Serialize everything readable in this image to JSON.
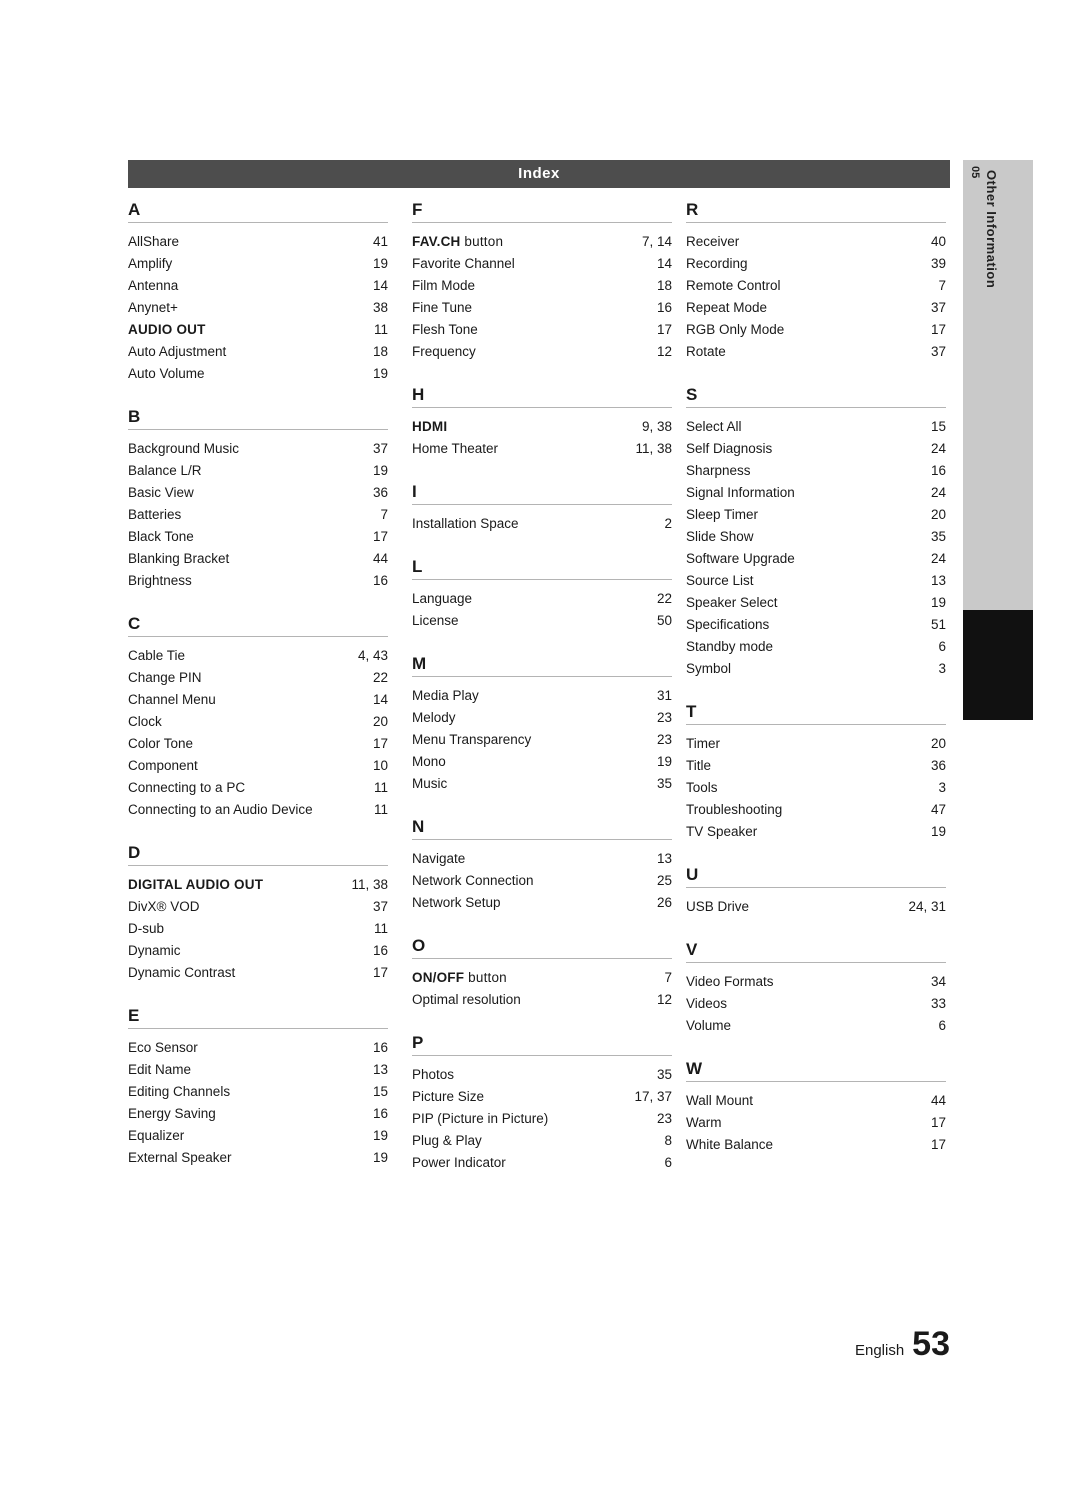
{
  "header": {
    "title": "Index"
  },
  "side_tab": {
    "number": "05",
    "label": "Other Information"
  },
  "footer": {
    "language": "English",
    "page_number": "53"
  },
  "columns": [
    {
      "groups": [
        {
          "letter": "A",
          "entries": [
            {
              "term": "AllShare",
              "page": "41",
              "bold": false
            },
            {
              "term": "Amplify",
              "page": "19",
              "bold": false
            },
            {
              "term": "Antenna",
              "page": "14",
              "bold": false
            },
            {
              "term": "Anynet+",
              "page": "38",
              "bold": false
            },
            {
              "term": "AUDIO OUT",
              "page": "11",
              "bold": true
            },
            {
              "term": "Auto Adjustment",
              "page": "18",
              "bold": false
            },
            {
              "term": "Auto Volume",
              "page": "19",
              "bold": false
            }
          ]
        },
        {
          "letter": "B",
          "entries": [
            {
              "term": "Background Music",
              "page": "37",
              "bold": false
            },
            {
              "term": "Balance L/R",
              "page": "19",
              "bold": false
            },
            {
              "term": "Basic View",
              "page": "36",
              "bold": false
            },
            {
              "term": "Batteries",
              "page": "7",
              "bold": false
            },
            {
              "term": "Black Tone",
              "page": "17",
              "bold": false
            },
            {
              "term": "Blanking Bracket",
              "page": "44",
              "bold": false
            },
            {
              "term": "Brightness",
              "page": "16",
              "bold": false
            }
          ]
        },
        {
          "letter": "C",
          "entries": [
            {
              "term": "Cable Tie",
              "page": "4, 43",
              "bold": false
            },
            {
              "term": "Change PIN",
              "page": "22",
              "bold": false
            },
            {
              "term": "Channel Menu",
              "page": "14",
              "bold": false
            },
            {
              "term": "Clock",
              "page": "20",
              "bold": false
            },
            {
              "term": "Color Tone",
              "page": "17",
              "bold": false
            },
            {
              "term": "Component",
              "page": "10",
              "bold": false
            },
            {
              "term": "Connecting to a PC",
              "page": "11",
              "bold": false
            },
            {
              "term": "Connecting to an Audio Device",
              "page": "11",
              "bold": false
            }
          ]
        },
        {
          "letter": "D",
          "entries": [
            {
              "term": "DIGITAL AUDIO OUT",
              "page": "11, 38",
              "bold": true
            },
            {
              "term": "DivX® VOD",
              "page": "37",
              "bold": false
            },
            {
              "term": "D-sub",
              "page": "11",
              "bold": false
            },
            {
              "term": "Dynamic",
              "page": "16",
              "bold": false
            },
            {
              "term": "Dynamic Contrast",
              "page": "17",
              "bold": false
            }
          ]
        },
        {
          "letter": "E",
          "entries": [
            {
              "term": "Eco Sensor",
              "page": "16",
              "bold": false
            },
            {
              "term": "Edit Name",
              "page": "13",
              "bold": false
            },
            {
              "term": "Editing Channels",
              "page": "15",
              "bold": false
            },
            {
              "term": "Energy Saving",
              "page": "16",
              "bold": false
            },
            {
              "term": "Equalizer",
              "page": "19",
              "bold": false
            },
            {
              "term": "External Speaker",
              "page": "19",
              "bold": false
            }
          ]
        }
      ]
    },
    {
      "groups": [
        {
          "letter": "F",
          "entries": [
            {
              "term": "FAV.CH",
              "suffix": " button",
              "page": "7, 14",
              "bold": true
            },
            {
              "term": "Favorite Channel",
              "page": "14",
              "bold": false
            },
            {
              "term": "Film Mode",
              "page": "18",
              "bold": false
            },
            {
              "term": "Fine Tune",
              "page": "16",
              "bold": false
            },
            {
              "term": "Flesh Tone",
              "page": "17",
              "bold": false
            },
            {
              "term": "Frequency",
              "page": "12",
              "bold": false
            }
          ]
        },
        {
          "letter": "H",
          "entries": [
            {
              "term": "HDMI",
              "page": "9, 38",
              "bold": true
            },
            {
              "term": "Home Theater",
              "page": "11, 38",
              "bold": false
            }
          ]
        },
        {
          "letter": "I",
          "entries": [
            {
              "term": "Installation Space",
              "page": "2",
              "bold": false
            }
          ]
        },
        {
          "letter": "L",
          "entries": [
            {
              "term": "Language",
              "page": "22",
              "bold": false
            },
            {
              "term": "License",
              "page": "50",
              "bold": false
            }
          ]
        },
        {
          "letter": "M",
          "entries": [
            {
              "term": "Media Play",
              "page": "31",
              "bold": false
            },
            {
              "term": "Melody",
              "page": "23",
              "bold": false
            },
            {
              "term": "Menu Transparency",
              "page": "23",
              "bold": false
            },
            {
              "term": "Mono",
              "page": "19",
              "bold": false
            },
            {
              "term": "Music",
              "page": "35",
              "bold": false
            }
          ]
        },
        {
          "letter": "N",
          "entries": [
            {
              "term": "Navigate",
              "page": "13",
              "bold": false
            },
            {
              "term": "Network Connection",
              "page": "25",
              "bold": false
            },
            {
              "term": "Network Setup",
              "page": "26",
              "bold": false
            }
          ]
        },
        {
          "letter": "O",
          "entries": [
            {
              "term": "ON/OFF",
              "suffix": " button",
              "page": "7",
              "bold": true
            },
            {
              "term": "Optimal resolution",
              "page": "12",
              "bold": false
            }
          ]
        },
        {
          "letter": "P",
          "entries": [
            {
              "term": "Photos",
              "page": "35",
              "bold": false
            },
            {
              "term": "Picture Size",
              "page": "17, 37",
              "bold": false
            },
            {
              "term": "PIP (Picture in Picture)",
              "page": "23",
              "bold": false
            },
            {
              "term": "Plug & Play",
              "page": "8",
              "bold": false
            },
            {
              "term": "Power Indicator",
              "page": "6",
              "bold": false
            }
          ]
        }
      ]
    },
    {
      "groups": [
        {
          "letter": "R",
          "entries": [
            {
              "term": "Receiver",
              "page": "40",
              "bold": false
            },
            {
              "term": "Recording",
              "page": "39",
              "bold": false
            },
            {
              "term": "Remote Control",
              "page": "7",
              "bold": false
            },
            {
              "term": "Repeat Mode",
              "page": "37",
              "bold": false
            },
            {
              "term": "RGB Only Mode",
              "page": "17",
              "bold": false
            },
            {
              "term": "Rotate",
              "page": "37",
              "bold": false
            }
          ]
        },
        {
          "letter": "S",
          "entries": [
            {
              "term": "Select All",
              "page": "15",
              "bold": false
            },
            {
              "term": "Self Diagnosis",
              "page": "24",
              "bold": false
            },
            {
              "term": "Sharpness",
              "page": "16",
              "bold": false
            },
            {
              "term": "Signal Information",
              "page": "24",
              "bold": false
            },
            {
              "term": "Sleep Timer",
              "page": "20",
              "bold": false
            },
            {
              "term": "Slide Show",
              "page": "35",
              "bold": false
            },
            {
              "term": "Software Upgrade",
              "page": "24",
              "bold": false
            },
            {
              "term": "Source List",
              "page": "13",
              "bold": false
            },
            {
              "term": "Speaker Select",
              "page": "19",
              "bold": false
            },
            {
              "term": "Specifications",
              "page": "51",
              "bold": false
            },
            {
              "term": "Standby mode",
              "page": "6",
              "bold": false
            },
            {
              "term": "Symbol",
              "page": "3",
              "bold": false
            }
          ]
        },
        {
          "letter": "T",
          "entries": [
            {
              "term": "Timer",
              "page": "20",
              "bold": false
            },
            {
              "term": "Title",
              "page": "36",
              "bold": false
            },
            {
              "term": "Tools",
              "page": "3",
              "bold": false
            },
            {
              "term": "Troubleshooting",
              "page": "47",
              "bold": false
            },
            {
              "term": "TV Speaker",
              "page": "19",
              "bold": false
            }
          ]
        },
        {
          "letter": "U",
          "entries": [
            {
              "term": "USB Drive",
              "page": "24, 31",
              "bold": false
            }
          ]
        },
        {
          "letter": "V",
          "entries": [
            {
              "term": "Video Formats",
              "page": "34",
              "bold": false
            },
            {
              "term": "Videos",
              "page": "33",
              "bold": false
            },
            {
              "term": "Volume",
              "page": "6",
              "bold": false
            }
          ]
        },
        {
          "letter": "W",
          "entries": [
            {
              "term": "Wall Mount",
              "page": "44",
              "bold": false
            },
            {
              "term": "Warm",
              "page": "17",
              "bold": false
            },
            {
              "term": "White Balance",
              "page": "17",
              "bold": false
            }
          ]
        }
      ]
    }
  ]
}
